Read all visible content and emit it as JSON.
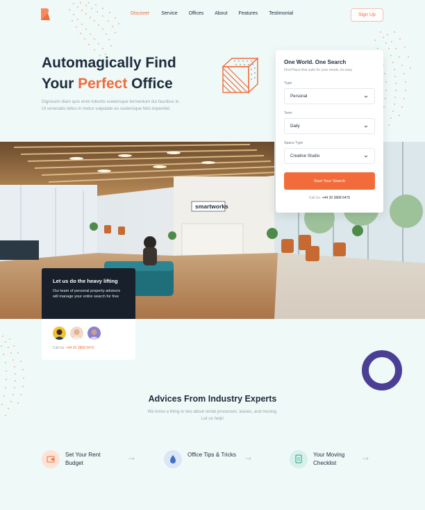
{
  "nav": {
    "items": [
      {
        "label": "Discover",
        "active": true
      },
      {
        "label": "Service",
        "active": false
      },
      {
        "label": "Offices",
        "active": false
      },
      {
        "label": "About",
        "active": false
      },
      {
        "label": "Features",
        "active": false
      },
      {
        "label": "Testimonial",
        "active": false
      }
    ],
    "signup_label": "Sign Up"
  },
  "hero": {
    "title_line1": "Automagically Find",
    "title_pre": "Your ",
    "title_accent": "Perfect",
    "title_post": " Office",
    "subtitle": "Dignissim diam quis enim lobortis scelerisque fermentum dui faucibus in. Ut venenatis tellus in metus vulputate eu scelerisque felis imperdiet."
  },
  "search_card": {
    "title": "One World. One Search",
    "subtitle": "Find Place that suits for  your needs, its easy",
    "fields": [
      {
        "label": "Type",
        "value": "Personal"
      },
      {
        "label": "Term",
        "value": "Daily"
      },
      {
        "label": "Space Type",
        "value": "Creative Studio"
      }
    ],
    "cta_label": "Start Your Search",
    "call_prefix": "Call Us: ",
    "call_number": "+44 20 3868 6470"
  },
  "photo": {
    "sign_text": "smartworks"
  },
  "help_box": {
    "title": "Let us do the heavy lifting",
    "text": "Our team of personal property advisors will manage your entire search for free",
    "call_prefix": "Call Us: ",
    "call_number": "+44 20 3868 6470"
  },
  "advices": {
    "title": "Advices From Industry Experts",
    "subtitle": "We know a thing or two about rental processes, leases, and moving. Let us help!",
    "items": [
      {
        "label": "Set Your Rent Budget",
        "icon": "wallet-icon",
        "color": "#fde3d6"
      },
      {
        "label": "Office Tips & Tricks",
        "icon": "drop-icon",
        "color": "#dbe6f7"
      },
      {
        "label": "Your Moving Checklist",
        "icon": "checklist-icon",
        "color": "#d5f1ea"
      }
    ]
  },
  "colors": {
    "accent": "#f26b3a",
    "background": "#eef9f8",
    "dark": "#17202b",
    "ring": "#4a3f95"
  }
}
